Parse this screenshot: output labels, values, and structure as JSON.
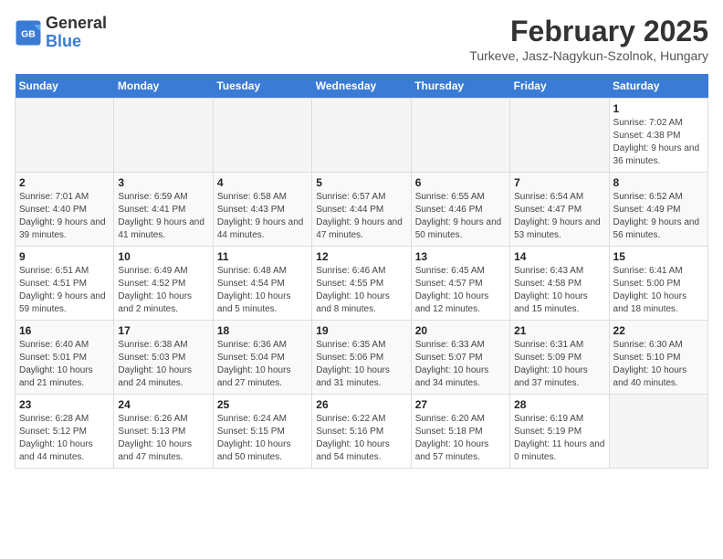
{
  "header": {
    "logo_line1": "General",
    "logo_line2": "Blue",
    "month": "February 2025",
    "location": "Turkeve, Jasz-Nagykun-Szolnok, Hungary"
  },
  "weekdays": [
    "Sunday",
    "Monday",
    "Tuesday",
    "Wednesday",
    "Thursday",
    "Friday",
    "Saturday"
  ],
  "weeks": [
    [
      {
        "day": "",
        "info": ""
      },
      {
        "day": "",
        "info": ""
      },
      {
        "day": "",
        "info": ""
      },
      {
        "day": "",
        "info": ""
      },
      {
        "day": "",
        "info": ""
      },
      {
        "day": "",
        "info": ""
      },
      {
        "day": "1",
        "info": "Sunrise: 7:02 AM\nSunset: 4:38 PM\nDaylight: 9 hours and 36 minutes."
      }
    ],
    [
      {
        "day": "2",
        "info": "Sunrise: 7:01 AM\nSunset: 4:40 PM\nDaylight: 9 hours and 39 minutes."
      },
      {
        "day": "3",
        "info": "Sunrise: 6:59 AM\nSunset: 4:41 PM\nDaylight: 9 hours and 41 minutes."
      },
      {
        "day": "4",
        "info": "Sunrise: 6:58 AM\nSunset: 4:43 PM\nDaylight: 9 hours and 44 minutes."
      },
      {
        "day": "5",
        "info": "Sunrise: 6:57 AM\nSunset: 4:44 PM\nDaylight: 9 hours and 47 minutes."
      },
      {
        "day": "6",
        "info": "Sunrise: 6:55 AM\nSunset: 4:46 PM\nDaylight: 9 hours and 50 minutes."
      },
      {
        "day": "7",
        "info": "Sunrise: 6:54 AM\nSunset: 4:47 PM\nDaylight: 9 hours and 53 minutes."
      },
      {
        "day": "8",
        "info": "Sunrise: 6:52 AM\nSunset: 4:49 PM\nDaylight: 9 hours and 56 minutes."
      }
    ],
    [
      {
        "day": "9",
        "info": "Sunrise: 6:51 AM\nSunset: 4:51 PM\nDaylight: 9 hours and 59 minutes."
      },
      {
        "day": "10",
        "info": "Sunrise: 6:49 AM\nSunset: 4:52 PM\nDaylight: 10 hours and 2 minutes."
      },
      {
        "day": "11",
        "info": "Sunrise: 6:48 AM\nSunset: 4:54 PM\nDaylight: 10 hours and 5 minutes."
      },
      {
        "day": "12",
        "info": "Sunrise: 6:46 AM\nSunset: 4:55 PM\nDaylight: 10 hours and 8 minutes."
      },
      {
        "day": "13",
        "info": "Sunrise: 6:45 AM\nSunset: 4:57 PM\nDaylight: 10 hours and 12 minutes."
      },
      {
        "day": "14",
        "info": "Sunrise: 6:43 AM\nSunset: 4:58 PM\nDaylight: 10 hours and 15 minutes."
      },
      {
        "day": "15",
        "info": "Sunrise: 6:41 AM\nSunset: 5:00 PM\nDaylight: 10 hours and 18 minutes."
      }
    ],
    [
      {
        "day": "16",
        "info": "Sunrise: 6:40 AM\nSunset: 5:01 PM\nDaylight: 10 hours and 21 minutes."
      },
      {
        "day": "17",
        "info": "Sunrise: 6:38 AM\nSunset: 5:03 PM\nDaylight: 10 hours and 24 minutes."
      },
      {
        "day": "18",
        "info": "Sunrise: 6:36 AM\nSunset: 5:04 PM\nDaylight: 10 hours and 27 minutes."
      },
      {
        "day": "19",
        "info": "Sunrise: 6:35 AM\nSunset: 5:06 PM\nDaylight: 10 hours and 31 minutes."
      },
      {
        "day": "20",
        "info": "Sunrise: 6:33 AM\nSunset: 5:07 PM\nDaylight: 10 hours and 34 minutes."
      },
      {
        "day": "21",
        "info": "Sunrise: 6:31 AM\nSunset: 5:09 PM\nDaylight: 10 hours and 37 minutes."
      },
      {
        "day": "22",
        "info": "Sunrise: 6:30 AM\nSunset: 5:10 PM\nDaylight: 10 hours and 40 minutes."
      }
    ],
    [
      {
        "day": "23",
        "info": "Sunrise: 6:28 AM\nSunset: 5:12 PM\nDaylight: 10 hours and 44 minutes."
      },
      {
        "day": "24",
        "info": "Sunrise: 6:26 AM\nSunset: 5:13 PM\nDaylight: 10 hours and 47 minutes."
      },
      {
        "day": "25",
        "info": "Sunrise: 6:24 AM\nSunset: 5:15 PM\nDaylight: 10 hours and 50 minutes."
      },
      {
        "day": "26",
        "info": "Sunrise: 6:22 AM\nSunset: 5:16 PM\nDaylight: 10 hours and 54 minutes."
      },
      {
        "day": "27",
        "info": "Sunrise: 6:20 AM\nSunset: 5:18 PM\nDaylight: 10 hours and 57 minutes."
      },
      {
        "day": "28",
        "info": "Sunrise: 6:19 AM\nSunset: 5:19 PM\nDaylight: 11 hours and 0 minutes."
      },
      {
        "day": "",
        "info": ""
      }
    ]
  ]
}
